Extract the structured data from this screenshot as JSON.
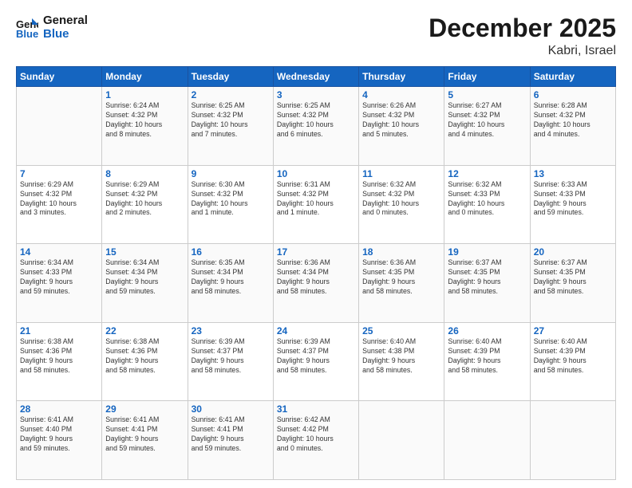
{
  "header": {
    "logo_line1": "General",
    "logo_line2": "Blue",
    "month": "December 2025",
    "location": "Kabri, Israel"
  },
  "days_of_week": [
    "Sunday",
    "Monday",
    "Tuesday",
    "Wednesday",
    "Thursday",
    "Friday",
    "Saturday"
  ],
  "weeks": [
    [
      {
        "day": "",
        "content": ""
      },
      {
        "day": "1",
        "content": "Sunrise: 6:24 AM\nSunset: 4:32 PM\nDaylight: 10 hours\nand 8 minutes."
      },
      {
        "day": "2",
        "content": "Sunrise: 6:25 AM\nSunset: 4:32 PM\nDaylight: 10 hours\nand 7 minutes."
      },
      {
        "day": "3",
        "content": "Sunrise: 6:25 AM\nSunset: 4:32 PM\nDaylight: 10 hours\nand 6 minutes."
      },
      {
        "day": "4",
        "content": "Sunrise: 6:26 AM\nSunset: 4:32 PM\nDaylight: 10 hours\nand 5 minutes."
      },
      {
        "day": "5",
        "content": "Sunrise: 6:27 AM\nSunset: 4:32 PM\nDaylight: 10 hours\nand 4 minutes."
      },
      {
        "day": "6",
        "content": "Sunrise: 6:28 AM\nSunset: 4:32 PM\nDaylight: 10 hours\nand 4 minutes."
      }
    ],
    [
      {
        "day": "7",
        "content": "Sunrise: 6:29 AM\nSunset: 4:32 PM\nDaylight: 10 hours\nand 3 minutes."
      },
      {
        "day": "8",
        "content": "Sunrise: 6:29 AM\nSunset: 4:32 PM\nDaylight: 10 hours\nand 2 minutes."
      },
      {
        "day": "9",
        "content": "Sunrise: 6:30 AM\nSunset: 4:32 PM\nDaylight: 10 hours\nand 1 minute."
      },
      {
        "day": "10",
        "content": "Sunrise: 6:31 AM\nSunset: 4:32 PM\nDaylight: 10 hours\nand 1 minute."
      },
      {
        "day": "11",
        "content": "Sunrise: 6:32 AM\nSunset: 4:32 PM\nDaylight: 10 hours\nand 0 minutes."
      },
      {
        "day": "12",
        "content": "Sunrise: 6:32 AM\nSunset: 4:33 PM\nDaylight: 10 hours\nand 0 minutes."
      },
      {
        "day": "13",
        "content": "Sunrise: 6:33 AM\nSunset: 4:33 PM\nDaylight: 9 hours\nand 59 minutes."
      }
    ],
    [
      {
        "day": "14",
        "content": "Sunrise: 6:34 AM\nSunset: 4:33 PM\nDaylight: 9 hours\nand 59 minutes."
      },
      {
        "day": "15",
        "content": "Sunrise: 6:34 AM\nSunset: 4:34 PM\nDaylight: 9 hours\nand 59 minutes."
      },
      {
        "day": "16",
        "content": "Sunrise: 6:35 AM\nSunset: 4:34 PM\nDaylight: 9 hours\nand 58 minutes."
      },
      {
        "day": "17",
        "content": "Sunrise: 6:36 AM\nSunset: 4:34 PM\nDaylight: 9 hours\nand 58 minutes."
      },
      {
        "day": "18",
        "content": "Sunrise: 6:36 AM\nSunset: 4:35 PM\nDaylight: 9 hours\nand 58 minutes."
      },
      {
        "day": "19",
        "content": "Sunrise: 6:37 AM\nSunset: 4:35 PM\nDaylight: 9 hours\nand 58 minutes."
      },
      {
        "day": "20",
        "content": "Sunrise: 6:37 AM\nSunset: 4:35 PM\nDaylight: 9 hours\nand 58 minutes."
      }
    ],
    [
      {
        "day": "21",
        "content": "Sunrise: 6:38 AM\nSunset: 4:36 PM\nDaylight: 9 hours\nand 58 minutes."
      },
      {
        "day": "22",
        "content": "Sunrise: 6:38 AM\nSunset: 4:36 PM\nDaylight: 9 hours\nand 58 minutes."
      },
      {
        "day": "23",
        "content": "Sunrise: 6:39 AM\nSunset: 4:37 PM\nDaylight: 9 hours\nand 58 minutes."
      },
      {
        "day": "24",
        "content": "Sunrise: 6:39 AM\nSunset: 4:37 PM\nDaylight: 9 hours\nand 58 minutes."
      },
      {
        "day": "25",
        "content": "Sunrise: 6:40 AM\nSunset: 4:38 PM\nDaylight: 9 hours\nand 58 minutes."
      },
      {
        "day": "26",
        "content": "Sunrise: 6:40 AM\nSunset: 4:39 PM\nDaylight: 9 hours\nand 58 minutes."
      },
      {
        "day": "27",
        "content": "Sunrise: 6:40 AM\nSunset: 4:39 PM\nDaylight: 9 hours\nand 58 minutes."
      }
    ],
    [
      {
        "day": "28",
        "content": "Sunrise: 6:41 AM\nSunset: 4:40 PM\nDaylight: 9 hours\nand 59 minutes."
      },
      {
        "day": "29",
        "content": "Sunrise: 6:41 AM\nSunset: 4:41 PM\nDaylight: 9 hours\nand 59 minutes."
      },
      {
        "day": "30",
        "content": "Sunrise: 6:41 AM\nSunset: 4:41 PM\nDaylight: 9 hours\nand 59 minutes."
      },
      {
        "day": "31",
        "content": "Sunrise: 6:42 AM\nSunset: 4:42 PM\nDaylight: 10 hours\nand 0 minutes."
      },
      {
        "day": "",
        "content": ""
      },
      {
        "day": "",
        "content": ""
      },
      {
        "day": "",
        "content": ""
      }
    ]
  ]
}
